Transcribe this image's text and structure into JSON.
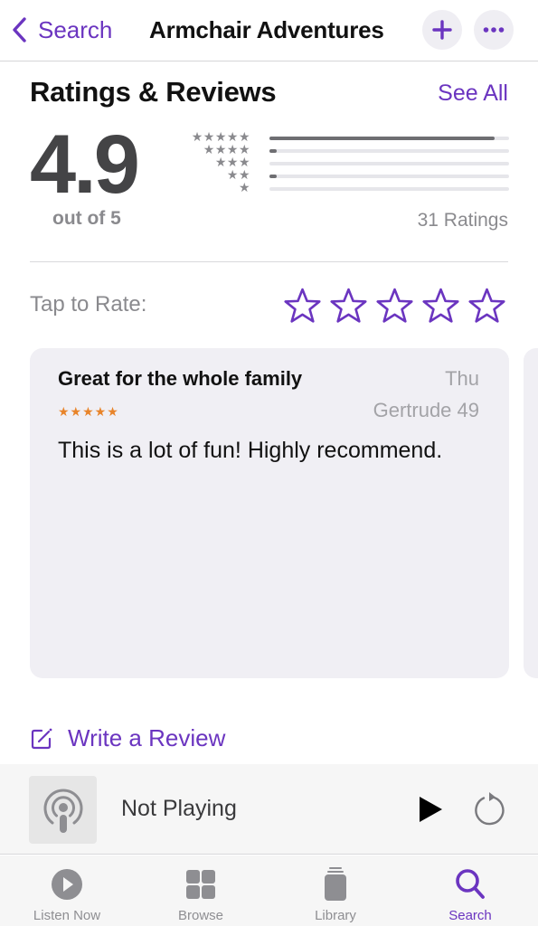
{
  "nav": {
    "back_label": "Search",
    "title": "Armchair Adventures",
    "add_icon": "plus-icon",
    "more_icon": "ellipsis-icon"
  },
  "ratings": {
    "section_title": "Ratings & Reviews",
    "see_all_label": "See All",
    "average": "4.9",
    "out_of_label": "out of 5",
    "count_label": "31 Ratings",
    "histogram": [
      {
        "stars": "★★★★★",
        "fraction": 0.94
      },
      {
        "stars": "★★★★",
        "fraction": 0.03
      },
      {
        "stars": "★★★",
        "fraction": 0.0
      },
      {
        "stars": "★★",
        "fraction": 0.03
      },
      {
        "stars": "★",
        "fraction": 0.0
      }
    ]
  },
  "tap_to_rate": {
    "label": "Tap to Rate:",
    "selected": 0,
    "max": 5
  },
  "reviews": [
    {
      "title": "Great for the whole family",
      "date": "Thu",
      "stars": "★★★★★",
      "author": "Gertrude 49",
      "body": "This is a lot of fun! Highly recommend."
    }
  ],
  "write_review_label": "Write a Review",
  "player": {
    "status": "Not Playing",
    "artwork_icon": "podcast-icon"
  },
  "tabs": [
    {
      "label": "Listen Now",
      "icon": "play-circle-icon",
      "active": false
    },
    {
      "label": "Browse",
      "icon": "grid-icon",
      "active": false
    },
    {
      "label": "Library",
      "icon": "library-icon",
      "active": false
    },
    {
      "label": "Search",
      "icon": "search-icon",
      "active": true
    }
  ],
  "colors": {
    "accent": "#6b35c0",
    "review_stars": "#e8842a",
    "card_bg": "#f0eff4"
  }
}
